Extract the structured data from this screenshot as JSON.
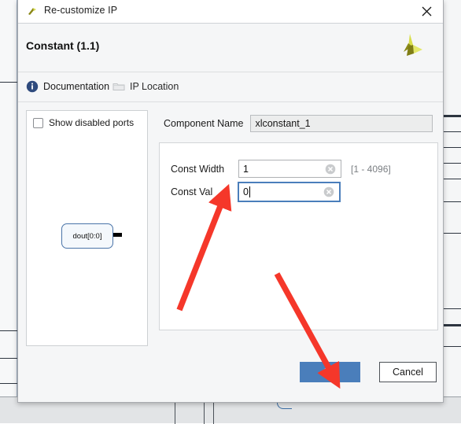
{
  "window": {
    "title": "Re-customize IP",
    "icon": "vivado-logo-icon",
    "close_label": "✕"
  },
  "header": {
    "title": "Constant (1.1)",
    "brand_icon": "xilinx-pinwheel-logo"
  },
  "links": [
    {
      "label": "Documentation",
      "icon": "info-icon"
    },
    {
      "label": "IP Location",
      "icon": "folder-icon"
    }
  ],
  "preview": {
    "show_disabled_ports_label": "Show disabled ports",
    "show_disabled_ports_checked": false,
    "block_label": "dout[0:0]"
  },
  "form": {
    "component_name_label": "Component Name",
    "component_name_value": "xlconstant_1",
    "fields": [
      {
        "label": "Const Width",
        "value": "1",
        "hint": "[1 - 4096]",
        "focused": false,
        "clear_icon": "clear-circle-icon"
      },
      {
        "label": "Const Val",
        "value": "0",
        "hint": "",
        "focused": true,
        "clear_icon": "clear-circle-icon"
      }
    ]
  },
  "buttons": {
    "ok_label": "OK",
    "cancel_label": "Cancel"
  },
  "colors": {
    "accent_blue": "#4a7ebb",
    "annotation_red": "#f5372a",
    "brand_olive": "#7f7d14",
    "brand_yellow": "#d8de4a",
    "info_blue": "#2e4a7d"
  }
}
